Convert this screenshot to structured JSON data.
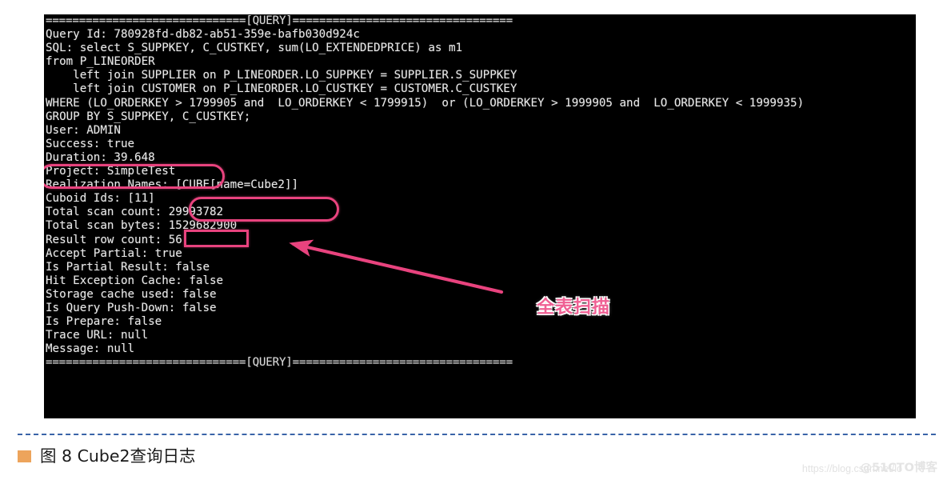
{
  "terminal": {
    "lines": [
      "==============================[QUERY]=================================",
      "Query Id: 780928fd-db82-ab51-359e-bafb030d924c",
      "SQL: select S_SUPPKEY, C_CUSTKEY, sum(LO_EXTENDEDPRICE) as m1",
      "from P_LINEORDER",
      "    left join SUPPLIER on P_LINEORDER.LO_SUPPKEY = SUPPLIER.S_SUPPKEY",
      "    left join CUSTOMER on P_LINEORDER.LO_CUSTKEY = CUSTOMER.C_CUSTKEY",
      "WHERE (LO_ORDERKEY > 1799905 and  LO_ORDERKEY < 1799915)  or (LO_ORDERKEY > 1999905 and  LO_ORDERKEY < 1999935)",
      "GROUP BY S_SUPPKEY, C_CUSTKEY;",
      "User: ADMIN",
      "Success: true",
      "Duration: 39.648",
      "Project: SimpleTest",
      "Realization Names: [CUBE[name=Cube2]]",
      "Cuboid Ids: [11]",
      "Total scan count: 29993782",
      "Total scan bytes: 1529682900",
      "Result row count: 56",
      "Accept Partial: true",
      "Is Partial Result: false",
      "Hit Exception Cache: false",
      "Storage cache used: false",
      "Is Query Push-Down: false",
      "Is Prepare: false",
      "Trace URL: null",
      "Message: null",
      "==============================[QUERY]================================="
    ]
  },
  "annotations": {
    "accent_color": "#e8437e",
    "duration_highlight_value": "Duration: 39.648",
    "cube_highlight_value": "[CUBE[name=Cube2]]",
    "scan_count_highlight_value": "29993782",
    "arrow_label": "全表扫描"
  },
  "caption": {
    "bullet_color": "#eda45c",
    "divider_color": "#3a64a8",
    "text": "图 8 Cube2查询日志"
  },
  "watermark": {
    "url": "https://blog.csdn.net/lo",
    "brand": "@51CTO博客"
  }
}
